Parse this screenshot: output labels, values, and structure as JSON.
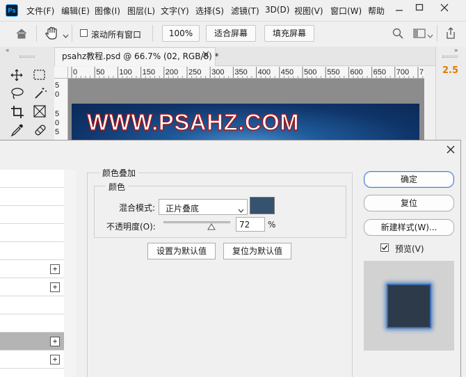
{
  "menubar": {
    "items": [
      "文件(F)",
      "编辑(E)",
      "图像(I)",
      "图层(L)",
      "文字(Y)",
      "选择(S)",
      "滤镜(T)",
      "3D(D)",
      "视图(V)",
      "窗口(W)",
      "帮助"
    ],
    "logo": "Ps"
  },
  "options_bar": {
    "scroll_all_windows_label": "滚动所有窗口",
    "zoom_value": "100%",
    "fit_screen_label": "适合屏幕",
    "fill_screen_label": "填充屏幕"
  },
  "document": {
    "tab_title": "psahz教程.psd @ 66.7% (02, RGB/8) *",
    "artwork_text": "WWW.PSAHZ.COM",
    "ruler_ticks": [
      "0",
      "50",
      "100",
      "150",
      "200",
      "250",
      "300",
      "350",
      "400",
      "450",
      "500",
      "550",
      "600",
      "650",
      "700",
      "7"
    ],
    "left_ruler_digits": [
      "5",
      "0",
      "5",
      "0",
      "5"
    ]
  },
  "right_panel": {
    "value": "2.5"
  },
  "dialog": {
    "section_title": "颜色叠加",
    "group_title": "颜色",
    "blend_mode_label": "混合模式:",
    "blend_mode_value": "正片叠底",
    "color_swatch": "#35536f",
    "opacity_label": "不透明度(O):",
    "opacity_value": "72",
    "opacity_unit": "%",
    "opacity_fraction": 0.72,
    "make_default_label": "设置为默认值",
    "reset_default_label": "复位为默认值",
    "ok_label": "确定",
    "reset_label": "复位",
    "new_style_label": "新建样式(W)...",
    "preview_label": "预览(V)",
    "preview_checked": true,
    "style_rows": [
      {
        "has_plus": false,
        "selected": false
      },
      {
        "has_plus": false,
        "selected": false
      },
      {
        "has_plus": false,
        "selected": false
      },
      {
        "has_plus": false,
        "selected": false
      },
      {
        "has_plus": false,
        "selected": false
      },
      {
        "has_plus": true,
        "selected": false
      },
      {
        "has_plus": true,
        "selected": false
      },
      {
        "has_plus": false,
        "selected": false
      },
      {
        "has_plus": false,
        "selected": false
      },
      {
        "has_plus": true,
        "selected": true
      },
      {
        "has_plus": true,
        "selected": false
      },
      {
        "has_plus": false,
        "selected": false
      }
    ]
  },
  "colors": {
    "accent": "#4a7bd0",
    "selected_row": "#b4b4b4",
    "artwork_text_stroke": "#a0181f",
    "right_panel_value": "#e07b00"
  }
}
